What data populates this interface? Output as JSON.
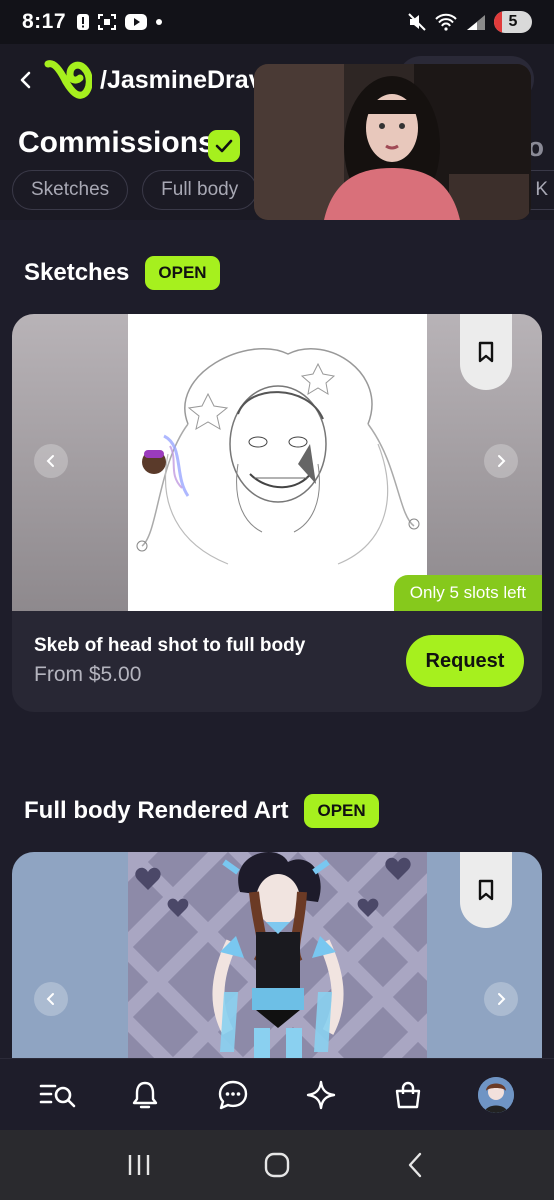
{
  "status_bar": {
    "time": "8:17",
    "battery_level": "5",
    "signal_label": "5"
  },
  "header": {
    "username": "/JasmineDrav",
    "page_title": "Commissions",
    "side_text": "io",
    "chips": [
      "Sketches",
      "Full body"
    ],
    "chip_right": "n K"
  },
  "sections": [
    {
      "title": "Sketches",
      "status": "OPEN",
      "item": {
        "title": "Skeb of head shot to full body",
        "price": "From $5.00",
        "slots": "Only 5 slots left",
        "request_label": "Request"
      }
    },
    {
      "title": "Full body Rendered Art",
      "status": "OPEN"
    }
  ],
  "colors": {
    "accent": "#a6f01e",
    "background": "#1e1d2a",
    "card": "#282734"
  },
  "bottom_nav": [
    "search-list-icon",
    "bell-icon",
    "chat-icon",
    "sparkle-icon",
    "shopping-bag-icon",
    "avatar"
  ],
  "system_nav": [
    "recents-icon",
    "home-icon",
    "back-icon"
  ]
}
